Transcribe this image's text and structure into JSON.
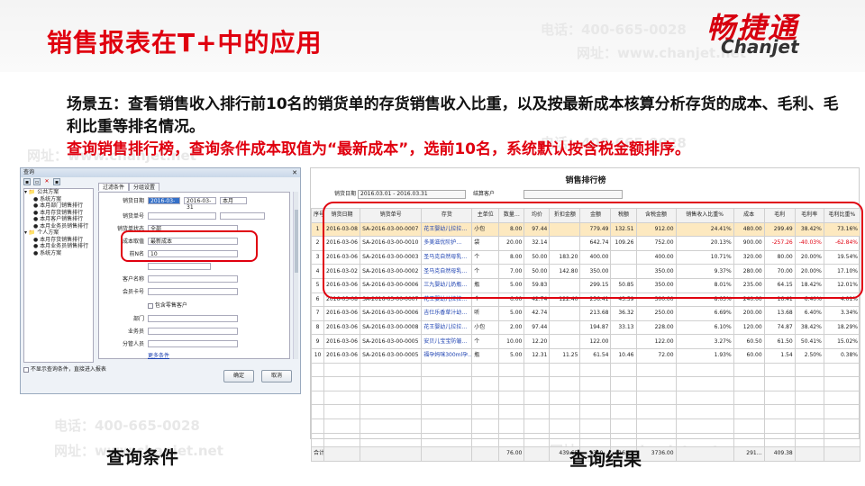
{
  "slide": {
    "title": "销售报表在T+中的应用",
    "logo_cn": "畅捷通",
    "logo_en": "Chanjet",
    "scene_label": "场景五：",
    "scene_text": "查看销售收入排行前10名的销货单的存货销售收入比重，以及按最新成本核算分析存货的成本、毛利、毛利比重等排名情况。",
    "scene_instruction": "查询销售排行榜，查询条件成本取值为“最新成本”，选前10名，系统默认按含税金额排序。",
    "caption_left": "查询条件",
    "caption_right": "查询结果",
    "watermark_phone": "电话：400-665-0028",
    "watermark_url": "网址：www.chanjet.net",
    "accent_color": "#e0000f"
  },
  "dialog": {
    "title": "查询",
    "close": "✕",
    "toolbar_icons": [
      "save-icon",
      "open-icon",
      "delete-icon",
      "copy-icon"
    ],
    "tree": [
      "公共方案",
      "系统方案",
      "本月部门销售排行",
      "本月存货销售排行",
      "本月客户销售排行",
      "本月业务员销售排行",
      "个人方案",
      "本月存货销售排行",
      "本月业务员销售排行",
      "系统方案"
    ],
    "tabs": [
      "过滤条件",
      "分组设置"
    ],
    "fields": {
      "date_label": "销货日期",
      "date_from": "2016-03-01",
      "date_to": "2016-03-31",
      "date_period": "本月",
      "doc_no_label": "销货单号",
      "doc_status_label": "销货单状态",
      "doc_status_value": "全部",
      "cost_label": "成本取值",
      "cost_value": "最新成本",
      "top_label": "前N名",
      "top_value": "10",
      "customer_code_label": "客户名称",
      "member_card_label": "会员卡号",
      "contains_retail_label": "包含零售客户",
      "dept_label": "部门",
      "salesman_label": "业务员",
      "category_label": "分管人员",
      "more_conditions": "更多条件"
    },
    "footer_checkbox": "不显示查询条件，直接进入报表",
    "ok_button": "确定",
    "cancel_button": "取消"
  },
  "report": {
    "title": "销售排行榜",
    "date_range_label": "销货日期",
    "date_range_value": "2016.03.01 - 2016.03.31",
    "customer_label": "结算客户",
    "columns": [
      "序号",
      "销货日期",
      "销货单号",
      "存货",
      "主单位",
      "数量…",
      "均价",
      "折扣金额",
      "金额",
      "税额",
      "含税金额",
      "销售收入比重%",
      "成本",
      "毛利",
      "毛利率",
      "毛利比重%"
    ],
    "rows": [
      [
        "1",
        "2016-03-08",
        "SA-2016-03-00-0007",
        "花王婴幼儿拉拉…",
        "小包",
        "8.00",
        "97.44",
        "",
        "779.49",
        "132.51",
        "912.00",
        "24.41%",
        "480.00",
        "299.49",
        "38.42%",
        "73.16%"
      ],
      [
        "2",
        "2016-03-06",
        "SA-2016-03-00-0010",
        "多美滋优阶护…",
        "袋",
        "20.00",
        "32.14",
        "",
        "642.74",
        "109.26",
        "752.00",
        "20.13%",
        "900.00",
        "-257.26",
        "-40.03%",
        "-62.84%"
      ],
      [
        "3",
        "2016-03-06",
        "SA-2016-03-00-0003",
        "圣马克自然母乳…",
        "个",
        "8.00",
        "50.00",
        "183.20",
        "400.00",
        "",
        "400.00",
        "10.71%",
        "320.00",
        "80.00",
        "20.00%",
        "19.54%"
      ],
      [
        "4",
        "2016-03-02",
        "SA-2016-03-00-0002",
        "圣马克自然母乳…",
        "个",
        "7.00",
        "50.00",
        "142.80",
        "350.00",
        "",
        "350.00",
        "9.37%",
        "280.00",
        "70.00",
        "20.00%",
        "17.10%"
      ],
      [
        "5",
        "2016-03-06",
        "SA-2016-03-00-0006",
        "三九婴幼儿奶瓶…",
        "瓶",
        "5.00",
        "59.83",
        "",
        "299.15",
        "50.85",
        "350.00",
        "8.01%",
        "235.00",
        "64.15",
        "18.42%",
        "12.01%"
      ],
      [
        "6",
        "2016-03-08",
        "SA-2016-03-00-0007",
        "花王婴幼儿拉拉…",
        "个",
        "6.00",
        "42.74",
        "122.40",
        "256.41",
        "43.59",
        "300.00",
        "8.03%",
        "240.00",
        "16.41",
        "6.40%",
        "4.01%"
      ],
      [
        "7",
        "2016-03-06",
        "SA-2016-03-00-0006",
        "吉仕乐香草汁幼…",
        "听",
        "5.00",
        "42.74",
        "",
        "213.68",
        "36.32",
        "250.00",
        "6.69%",
        "200.00",
        "13.68",
        "6.40%",
        "3.34%"
      ],
      [
        "8",
        "2016-03-06",
        "SA-2016-03-00-0008",
        "花王婴幼儿拉拉…",
        "小包",
        "2.00",
        "97.44",
        "",
        "194.87",
        "33.13",
        "228.00",
        "6.10%",
        "120.00",
        "74.87",
        "38.42%",
        "18.29%"
      ],
      [
        "9",
        "2016-03-06",
        "SA-2016-03-00-0005",
        "安贝儿宝宝防皱…",
        "个",
        "10.00",
        "12.20",
        "",
        "122.00",
        "",
        "122.00",
        "3.27%",
        "60.50",
        "61.50",
        "50.41%",
        "15.02%"
      ],
      [
        "10",
        "2016-03-06",
        "SA-2016-03-00-0005",
        "福孕妈咪300ml孕…",
        "瓶",
        "5.00",
        "12.31",
        "11.25",
        "61.54",
        "10.46",
        "72.00",
        "1.93%",
        "60.00",
        "1.54",
        "2.50%",
        "0.38%"
      ]
    ],
    "total_row": [
      "合计",
      "",
      "",
      "",
      "",
      "76.00",
      "",
      "439.65",
      "3319…",
      "416.12",
      "3736.00",
      "",
      "291…",
      "409.38",
      "",
      ""
    ]
  }
}
